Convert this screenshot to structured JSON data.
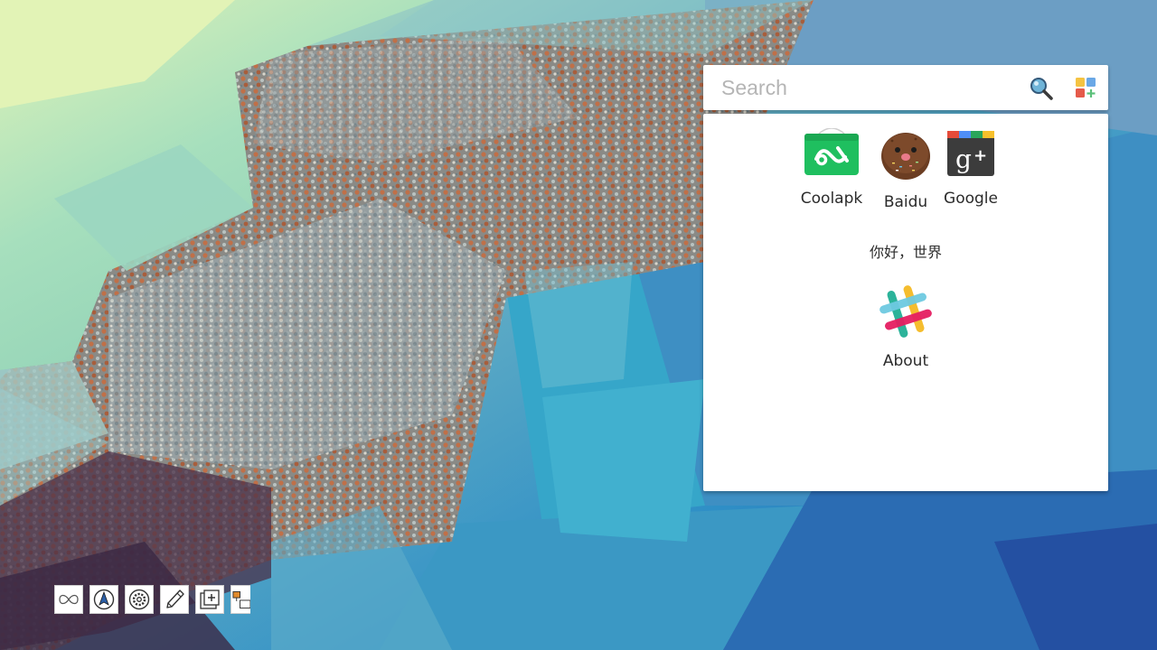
{
  "search": {
    "placeholder": "Search"
  },
  "apps": [
    {
      "label": "Coolapk",
      "icon": "coolapk-icon",
      "color": "#1fbf5f"
    },
    {
      "label": "Baidu",
      "icon": "baidu-bean-icon",
      "color": "#6b3d22"
    },
    {
      "label": "Google",
      "icon": "google-plus-icon",
      "color": "#3c3c3c"
    }
  ],
  "greeting": "你好，世界",
  "about": {
    "label": "About",
    "icon": "slack-hash-icon"
  },
  "taskbar": [
    {
      "icon": "infinity-icon"
    },
    {
      "icon": "navigation-icon"
    },
    {
      "icon": "settings-gear-icon"
    },
    {
      "icon": "pencil-icon"
    },
    {
      "icon": "add-window-icon"
    },
    {
      "icon": "desktop-widget-icon"
    }
  ]
}
